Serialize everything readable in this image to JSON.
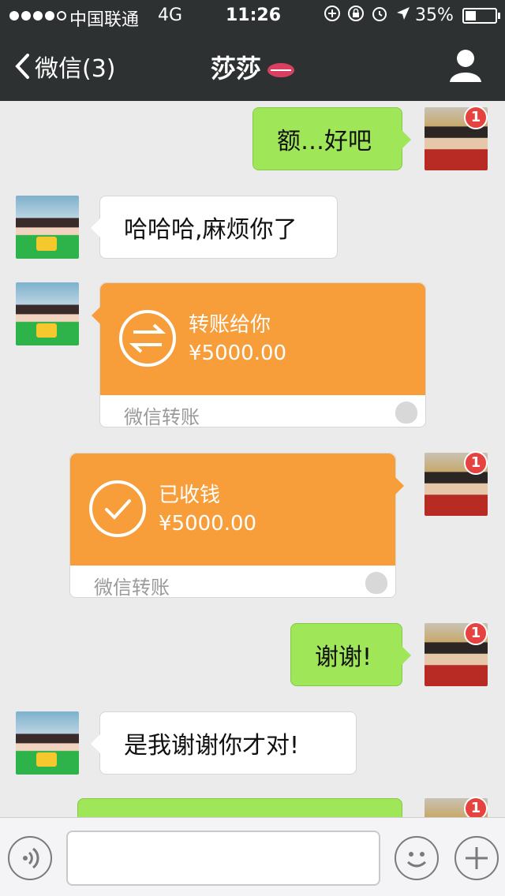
{
  "status_bar": {
    "signal_dots": 5,
    "signal_filled": 4,
    "carrier": "中国联通",
    "network": "4G",
    "time": "11:26",
    "battery_percent": "35%",
    "battery_level": 0.35,
    "icons": [
      "lock-rotation-icon",
      "lock-icon",
      "alarm-icon",
      "location-arrow-icon"
    ]
  },
  "nav": {
    "back_label": "微信(3)",
    "title": "莎莎",
    "title_emoji": "lips-icon",
    "profile_icon": "person-icon"
  },
  "messages": [
    {
      "side": "right",
      "type": "text",
      "text": "额…好吧",
      "badge": "1"
    },
    {
      "side": "left",
      "type": "text",
      "text": "哈哈哈,麻烦你了"
    },
    {
      "side": "left",
      "type": "transfer",
      "title": "转账给你",
      "amount": "¥5000.00",
      "footer": "微信转账",
      "icon": "transfer-arrows-icon"
    },
    {
      "side": "right",
      "type": "transfer",
      "title": "已收钱",
      "amount": "¥5000.00",
      "footer": "微信转账",
      "icon": "checkmark-icon",
      "badge": "1"
    },
    {
      "side": "right",
      "type": "text",
      "text": "谢谢!",
      "badge": "1"
    },
    {
      "side": "left",
      "type": "text",
      "text": "是我谢谢你才对!"
    },
    {
      "side": "right",
      "type": "text",
      "text": "",
      "badge": "1",
      "partial": true
    }
  ],
  "input_bar": {
    "voice_icon": "voice-icon",
    "input_value": "",
    "emoji_icon": "emoji-icon",
    "plus_icon": "plus-icon"
  },
  "colors": {
    "nav_bg": "#2e3132",
    "chat_bg": "#ebebeb",
    "green_bubble": "#9fe658",
    "transfer_orange": "#f79d3a",
    "badge_red": "#e64340"
  }
}
